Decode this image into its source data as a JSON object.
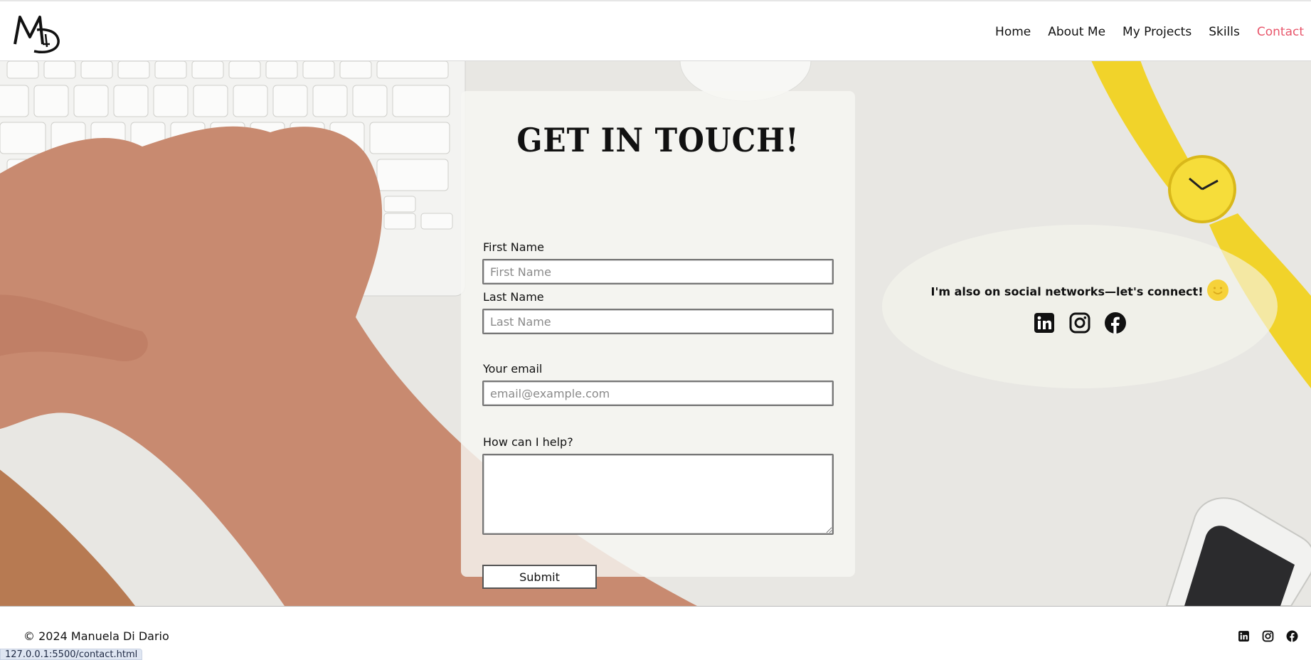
{
  "header": {
    "logo_text": "MD",
    "nav": [
      {
        "label": "Home"
      },
      {
        "label": "About Me"
      },
      {
        "label": "My Projects"
      },
      {
        "label": "Skills"
      },
      {
        "label": "Contact",
        "active": true
      }
    ],
    "active_color": "#e8566b"
  },
  "contact": {
    "title": "GET IN TOUCH!",
    "first_name": {
      "label": "First Name",
      "placeholder": "First Name",
      "value": ""
    },
    "last_name": {
      "label": "Last Name",
      "placeholder": "Last Name",
      "value": ""
    },
    "email": {
      "label": "Your email",
      "placeholder": "email@example.com",
      "value": ""
    },
    "message": {
      "label": "How can I help?",
      "value": ""
    },
    "submit_label": "Submit"
  },
  "social": {
    "text": "I'm also on social networks—let's connect!",
    "icons": [
      "linkedin-icon",
      "instagram-icon",
      "facebook-icon"
    ],
    "smiley_color": "#f6d23a"
  },
  "footer": {
    "copyright": "© 2024 Manuela Di Dario",
    "icons": [
      "linkedin-icon",
      "instagram-icon",
      "facebook-icon"
    ]
  },
  "status_bar": {
    "url": "127.0.0.1:5500/contact.html"
  }
}
